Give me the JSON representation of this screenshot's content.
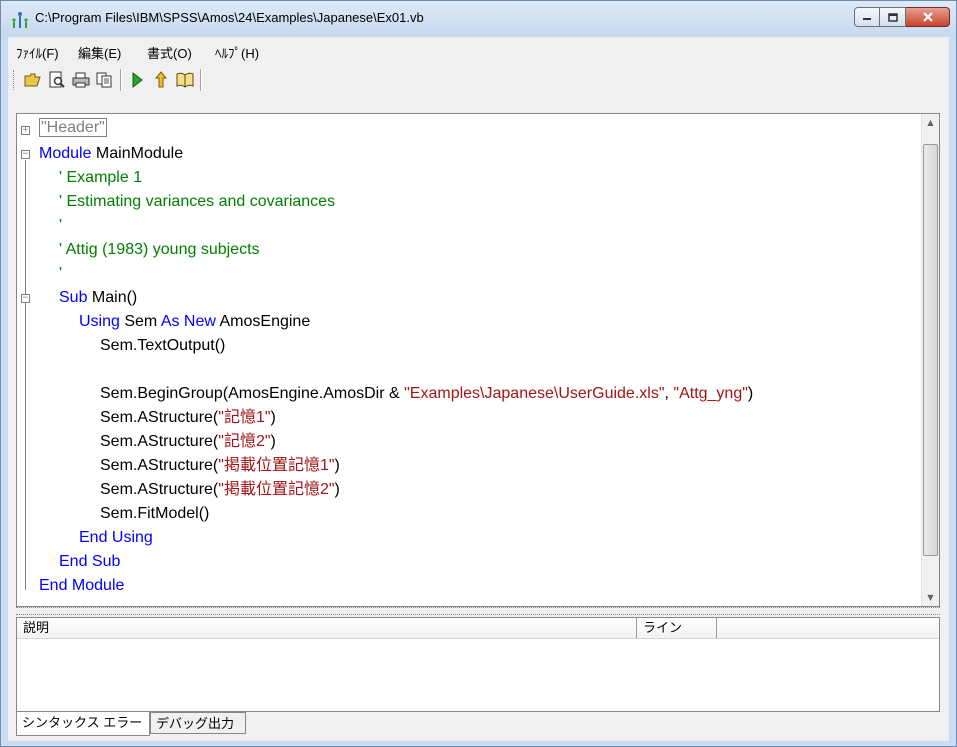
{
  "window": {
    "title": "C:\\Program Files\\IBM\\SPSS\\Amos\\24\\Examples\\Japanese\\Ex01.vb"
  },
  "menu": {
    "items": [
      {
        "label": "ﾌｧｲﾙ(F)"
      },
      {
        "label": "編集(E)"
      },
      {
        "label": "書式(O)"
      },
      {
        "label": "ﾍﾙﾌﾟ(H)"
      }
    ]
  },
  "toolbar": {
    "buttons": [
      "open-folder-icon",
      "print-preview-icon",
      "print-icon",
      "copy-icon",
      "run-icon",
      "step-icon",
      "help-book-icon"
    ]
  },
  "editor": {
    "header_label": "\"Header\"",
    "lines": [
      {
        "k1": "Module",
        "t1": " MainModule"
      },
      {
        "c": "' Example 1"
      },
      {
        "c": "' Estimating variances and covariances"
      },
      {
        "c": "'"
      },
      {
        "c": "' Attig (1983) young subjects"
      },
      {
        "c": "'"
      },
      {
        "k1": "Sub",
        "t1": " Main()"
      },
      {
        "k1": "Using",
        "t1": " Sem ",
        "k2": "As New",
        "t2": " AmosEngine"
      },
      {
        "t1": "Sem.TextOutput()"
      },
      {
        "t1": ""
      },
      {
        "t1": "Sem.BeginGroup(AmosEngine.AmosDir & ",
        "s1": "\"Examples\\Japanese\\UserGuide.xls\"",
        "t2": ", ",
        "s2": "\"Attg_yng\"",
        "t3": ")"
      },
      {
        "t1": "Sem.AStructure(",
        "s1": "\"記憶1\"",
        "t2": ")"
      },
      {
        "t1": "Sem.AStructure(",
        "s1": "\"記憶2\"",
        "t2": ")"
      },
      {
        "t1": "Sem.AStructure(",
        "s1": "\"掲載位置記憶1\"",
        "t2": ")"
      },
      {
        "t1": "Sem.AStructure(",
        "s1": "\"掲載位置記憶2\"",
        "t2": ")"
      },
      {
        "t1": "Sem.FitModel()"
      },
      {
        "k1": "End Using"
      },
      {
        "k1": "End Sub"
      },
      {
        "k1": "End Module"
      }
    ]
  },
  "error_panel": {
    "columns": [
      "説明",
      "ライン",
      ""
    ]
  },
  "tabs": [
    {
      "label": "シンタックス エラー",
      "active": true
    },
    {
      "label": "デバッグ出力",
      "active": false
    }
  ],
  "colors": {
    "keyword": "#0000ff",
    "comment": "#008000",
    "string": "#a31515"
  }
}
